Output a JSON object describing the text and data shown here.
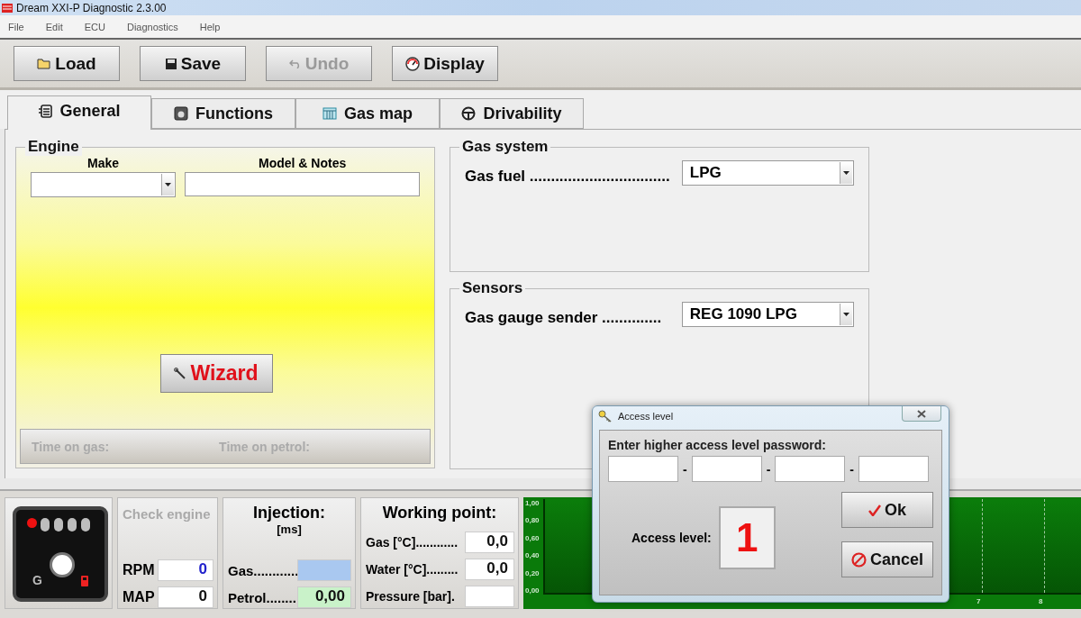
{
  "window": {
    "title": "Dream XXI-P Diagnostic 2.3.00"
  },
  "menu": [
    "File",
    "Edit",
    "ECU",
    "Diagnostics",
    "Help"
  ],
  "toolbar": [
    {
      "label": "Load",
      "kind": "load",
      "disabled": false
    },
    {
      "label": "Save",
      "kind": "save",
      "disabled": false
    },
    {
      "label": "Undo",
      "kind": "undo",
      "disabled": true
    },
    {
      "label": "Display",
      "kind": "display",
      "disabled": false
    }
  ],
  "tabs": [
    {
      "label": "General",
      "kind": "general",
      "selected": true
    },
    {
      "label": "Functions",
      "kind": "functions",
      "selected": false
    },
    {
      "label": "Gas map",
      "kind": "map",
      "selected": false
    },
    {
      "label": "Drivability",
      "kind": "drivability",
      "selected": false
    }
  ],
  "engine": {
    "title": "Engine",
    "make_label": "Make",
    "model_label": "Model & Notes",
    "wizard": "Wizard",
    "time_on_gas": "Time on gas:",
    "time_on_petrol": "Time on petrol:"
  },
  "gas_system": {
    "title": "Gas system",
    "fields": [
      {
        "label": "Gas fuel .................................",
        "value": "LPG"
      }
    ]
  },
  "sensors": {
    "title": "Sensors",
    "fields": [
      {
        "label": "Gas gauge sender ..............",
        "value": "REG 1090 LPG"
      }
    ]
  },
  "switch_panel": {
    "leds": [
      {
        "on": true
      },
      {
        "on": false
      },
      {
        "on": false
      },
      {
        "on": false
      },
      {
        "on": false
      }
    ],
    "label": "G"
  },
  "check_engine": {
    "label": "Check engine",
    "active": false,
    "readings": [
      {
        "label": "RPM",
        "value": "0",
        "kind": "highlight"
      },
      {
        "label": "MAP",
        "value": "0",
        "kind": "plain"
      }
    ]
  },
  "injection": {
    "title": "Injection:",
    "unit": "[ms]",
    "rows": [
      {
        "label": "Gas............",
        "color": "#a9c8f0"
      },
      {
        "label": "Petrol........",
        "value": "0,00",
        "color": "#c9f2c9"
      }
    ]
  },
  "working_point": {
    "title": "Working point:",
    "rows": [
      {
        "label": "Gas [°C]............",
        "value": "0,0"
      },
      {
        "label": "Water [°C].........",
        "value": "0,0"
      },
      {
        "label": "Pressure [bar]."
      }
    ]
  },
  "graph": {
    "y_labels": [
      "1,00",
      "0,80",
      "0,60",
      "0,40",
      "0,20",
      "0,00"
    ],
    "x_labels": [
      "7",
      "8"
    ]
  },
  "dialog": {
    "title": "Access level",
    "prompt": "Enter higher access level password:",
    "separators": [
      "-",
      "-",
      "-"
    ],
    "access_label": "Access level:",
    "access_value": "1",
    "buttons": [
      {
        "label": "Ok",
        "kind": "ok"
      },
      {
        "label": "Cancel",
        "kind": "cancel"
      }
    ]
  }
}
